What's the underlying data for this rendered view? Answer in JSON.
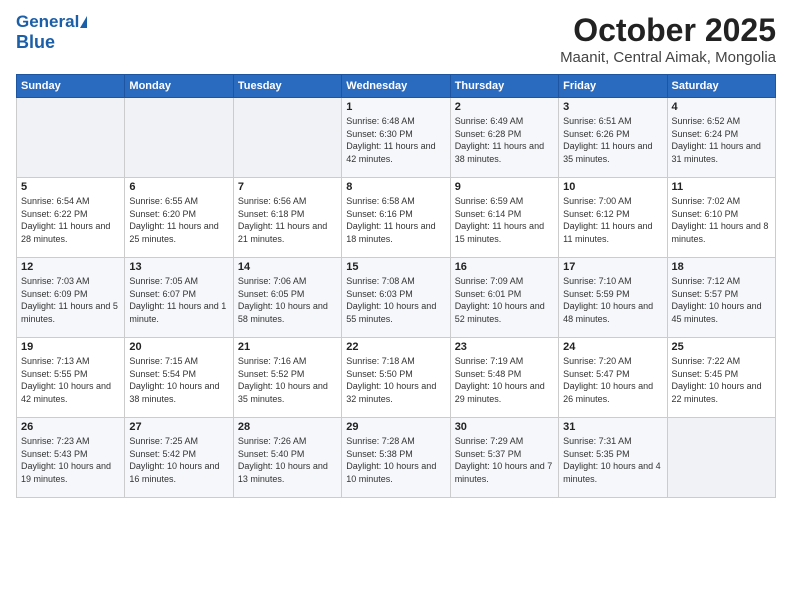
{
  "header": {
    "logo_line1": "General",
    "logo_line2": "Blue",
    "title": "October 2025",
    "subtitle": "Maanit, Central Aimak, Mongolia"
  },
  "calendar": {
    "days_of_week": [
      "Sunday",
      "Monday",
      "Tuesday",
      "Wednesday",
      "Thursday",
      "Friday",
      "Saturday"
    ],
    "weeks": [
      [
        {
          "day": "",
          "info": ""
        },
        {
          "day": "",
          "info": ""
        },
        {
          "day": "",
          "info": ""
        },
        {
          "day": "1",
          "info": "Sunrise: 6:48 AM\nSunset: 6:30 PM\nDaylight: 11 hours\nand 42 minutes."
        },
        {
          "day": "2",
          "info": "Sunrise: 6:49 AM\nSunset: 6:28 PM\nDaylight: 11 hours\nand 38 minutes."
        },
        {
          "day": "3",
          "info": "Sunrise: 6:51 AM\nSunset: 6:26 PM\nDaylight: 11 hours\nand 35 minutes."
        },
        {
          "day": "4",
          "info": "Sunrise: 6:52 AM\nSunset: 6:24 PM\nDaylight: 11 hours\nand 31 minutes."
        }
      ],
      [
        {
          "day": "5",
          "info": "Sunrise: 6:54 AM\nSunset: 6:22 PM\nDaylight: 11 hours\nand 28 minutes."
        },
        {
          "day": "6",
          "info": "Sunrise: 6:55 AM\nSunset: 6:20 PM\nDaylight: 11 hours\nand 25 minutes."
        },
        {
          "day": "7",
          "info": "Sunrise: 6:56 AM\nSunset: 6:18 PM\nDaylight: 11 hours\nand 21 minutes."
        },
        {
          "day": "8",
          "info": "Sunrise: 6:58 AM\nSunset: 6:16 PM\nDaylight: 11 hours\nand 18 minutes."
        },
        {
          "day": "9",
          "info": "Sunrise: 6:59 AM\nSunset: 6:14 PM\nDaylight: 11 hours\nand 15 minutes."
        },
        {
          "day": "10",
          "info": "Sunrise: 7:00 AM\nSunset: 6:12 PM\nDaylight: 11 hours\nand 11 minutes."
        },
        {
          "day": "11",
          "info": "Sunrise: 7:02 AM\nSunset: 6:10 PM\nDaylight: 11 hours\nand 8 minutes."
        }
      ],
      [
        {
          "day": "12",
          "info": "Sunrise: 7:03 AM\nSunset: 6:09 PM\nDaylight: 11 hours\nand 5 minutes."
        },
        {
          "day": "13",
          "info": "Sunrise: 7:05 AM\nSunset: 6:07 PM\nDaylight: 11 hours\nand 1 minute."
        },
        {
          "day": "14",
          "info": "Sunrise: 7:06 AM\nSunset: 6:05 PM\nDaylight: 10 hours\nand 58 minutes."
        },
        {
          "day": "15",
          "info": "Sunrise: 7:08 AM\nSunset: 6:03 PM\nDaylight: 10 hours\nand 55 minutes."
        },
        {
          "day": "16",
          "info": "Sunrise: 7:09 AM\nSunset: 6:01 PM\nDaylight: 10 hours\nand 52 minutes."
        },
        {
          "day": "17",
          "info": "Sunrise: 7:10 AM\nSunset: 5:59 PM\nDaylight: 10 hours\nand 48 minutes."
        },
        {
          "day": "18",
          "info": "Sunrise: 7:12 AM\nSunset: 5:57 PM\nDaylight: 10 hours\nand 45 minutes."
        }
      ],
      [
        {
          "day": "19",
          "info": "Sunrise: 7:13 AM\nSunset: 5:55 PM\nDaylight: 10 hours\nand 42 minutes."
        },
        {
          "day": "20",
          "info": "Sunrise: 7:15 AM\nSunset: 5:54 PM\nDaylight: 10 hours\nand 38 minutes."
        },
        {
          "day": "21",
          "info": "Sunrise: 7:16 AM\nSunset: 5:52 PM\nDaylight: 10 hours\nand 35 minutes."
        },
        {
          "day": "22",
          "info": "Sunrise: 7:18 AM\nSunset: 5:50 PM\nDaylight: 10 hours\nand 32 minutes."
        },
        {
          "day": "23",
          "info": "Sunrise: 7:19 AM\nSunset: 5:48 PM\nDaylight: 10 hours\nand 29 minutes."
        },
        {
          "day": "24",
          "info": "Sunrise: 7:20 AM\nSunset: 5:47 PM\nDaylight: 10 hours\nand 26 minutes."
        },
        {
          "day": "25",
          "info": "Sunrise: 7:22 AM\nSunset: 5:45 PM\nDaylight: 10 hours\nand 22 minutes."
        }
      ],
      [
        {
          "day": "26",
          "info": "Sunrise: 7:23 AM\nSunset: 5:43 PM\nDaylight: 10 hours\nand 19 minutes."
        },
        {
          "day": "27",
          "info": "Sunrise: 7:25 AM\nSunset: 5:42 PM\nDaylight: 10 hours\nand 16 minutes."
        },
        {
          "day": "28",
          "info": "Sunrise: 7:26 AM\nSunset: 5:40 PM\nDaylight: 10 hours\nand 13 minutes."
        },
        {
          "day": "29",
          "info": "Sunrise: 7:28 AM\nSunset: 5:38 PM\nDaylight: 10 hours\nand 10 minutes."
        },
        {
          "day": "30",
          "info": "Sunrise: 7:29 AM\nSunset: 5:37 PM\nDaylight: 10 hours\nand 7 minutes."
        },
        {
          "day": "31",
          "info": "Sunrise: 7:31 AM\nSunset: 5:35 PM\nDaylight: 10 hours\nand 4 minutes."
        },
        {
          "day": "",
          "info": ""
        }
      ]
    ]
  }
}
